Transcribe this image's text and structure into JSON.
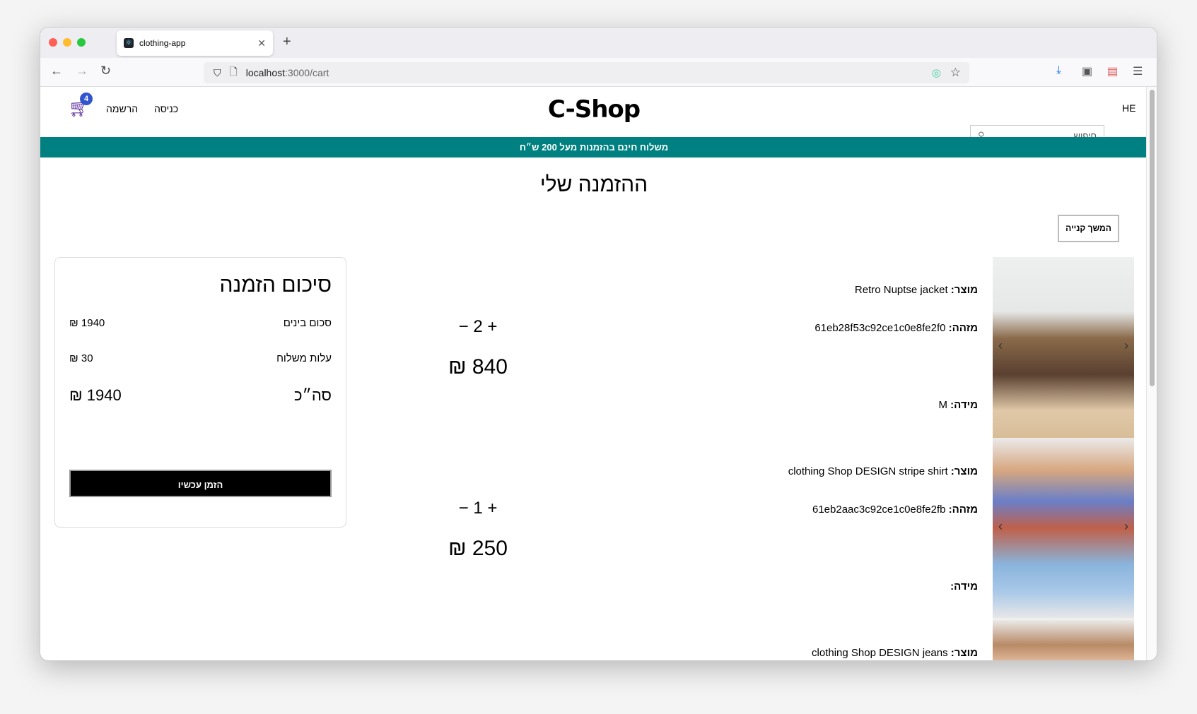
{
  "browser": {
    "tab_title": "clothing-app",
    "url_host": "localhost",
    "url_path": ":3000/cart"
  },
  "header": {
    "logo": "C-Shop",
    "cart_count": "4",
    "register": "הרשמה",
    "login": "כניסה",
    "search_placeholder": "חיפוש",
    "language": "HE"
  },
  "banner": "משלוח חינם בהזמנות מעל 200 ש״ח",
  "page_title": "ההזמנה שלי",
  "continue_shopping": "המשך קנייה",
  "summary": {
    "title": "סיכום הזמנה",
    "subtotal_label": "סכום בינים",
    "subtotal": "1940 ₪",
    "shipping_label": "עלות משלוח",
    "shipping": "30 ₪",
    "total_label": "סה״כ",
    "total": "1940 ₪",
    "order_button": "הזמן עכשיו"
  },
  "labels": {
    "product": "מוצר:",
    "id": "מזהה:",
    "size": "מידה:"
  },
  "items": [
    {
      "name": "Retro Nuptse jacket",
      "id": "61eb28f53c92ce1c0e8fe2f0",
      "size": "M",
      "qty": "2",
      "price": "840 ₪"
    },
    {
      "name": "clothing Shop DESIGN stripe shirt",
      "id": "61eb2aac3c92ce1c0e8fe2fb",
      "size": "",
      "qty": "1",
      "price": "250 ₪"
    },
    {
      "name": "clothing Shop DESIGN jeans"
    }
  ],
  "colors": {
    "banner": "#008080",
    "badge": "#3355cc",
    "cart": "#5b2a9a"
  }
}
